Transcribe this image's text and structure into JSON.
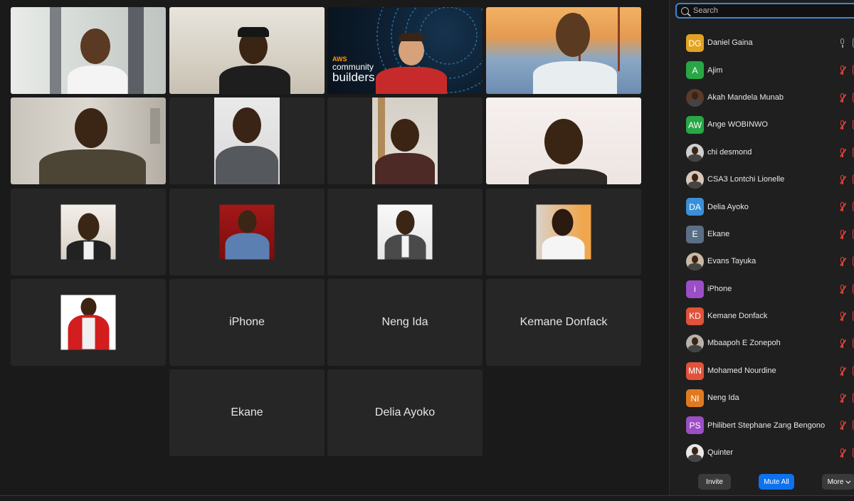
{
  "gallery": {
    "name_tiles": {
      "iphone": "iPhone",
      "neng": "Neng Ida",
      "kemane": "Kemane Donfack",
      "ekane": "Ekane",
      "delia": "Delia Ayoko"
    },
    "aws_logo": {
      "small": "AWS",
      "line1": "community",
      "line2": "builders"
    }
  },
  "panel": {
    "search_placeholder": "Search",
    "participants": [
      {
        "name": "Daniel Gaina",
        "initials": "DG",
        "color": "#e2a323",
        "mic": "on",
        "video": "on"
      },
      {
        "name": "Ajim",
        "initials": "A",
        "color": "#28a745",
        "mic": "muted",
        "video": "off"
      },
      {
        "name": "Akah Mandela Munab",
        "initials": "",
        "color": "#5b3a2a",
        "mic": "muted",
        "video": "off"
      },
      {
        "name": "Ange WOBINWO",
        "initials": "AW",
        "color": "#28a745",
        "mic": "muted",
        "video": "off"
      },
      {
        "name": "chi desmond",
        "initials": "",
        "color": "#cfcfcf",
        "mic": "muted",
        "video": "off"
      },
      {
        "name": "CSA3 Lontchi Lionelle",
        "initials": "",
        "color": "#d9c7b8",
        "mic": "muted",
        "video": "off"
      },
      {
        "name": "Delia Ayoko",
        "initials": "DA",
        "color": "#3a8fd8",
        "mic": "muted",
        "video": "off"
      },
      {
        "name": "Ekane",
        "initials": "E",
        "color": "#5a6f86",
        "mic": "muted",
        "video": "off"
      },
      {
        "name": "Evans Tayuka",
        "initials": "",
        "color": "#c9b9a6",
        "mic": "muted",
        "video": "off"
      },
      {
        "name": "iPhone",
        "initials": "i",
        "color": "#9b4ec6",
        "mic": "muted",
        "video": "off"
      },
      {
        "name": "Kemane Donfack",
        "initials": "KD",
        "color": "#e0523a",
        "mic": "muted",
        "video": "off"
      },
      {
        "name": "Mbaapoh E Zonepoh",
        "initials": "",
        "color": "#b7b2aa",
        "mic": "muted",
        "video": "off"
      },
      {
        "name": "Mohamed Nourdine",
        "initials": "MN",
        "color": "#e0523a",
        "mic": "muted",
        "video": "off"
      },
      {
        "name": "Neng Ida",
        "initials": "NI",
        "color": "#e07a20",
        "mic": "muted",
        "video": "off"
      },
      {
        "name": "Philibert Stephane Zang Bengono",
        "initials": "PS",
        "color": "#9b4ec6",
        "mic": "muted",
        "video": "off"
      },
      {
        "name": "Quinter",
        "initials": "",
        "color": "#e8e8e8",
        "mic": "muted",
        "video": "off"
      }
    ],
    "buttons": {
      "invite": "Invite",
      "mute_all": "Mute All",
      "more": "More"
    }
  }
}
